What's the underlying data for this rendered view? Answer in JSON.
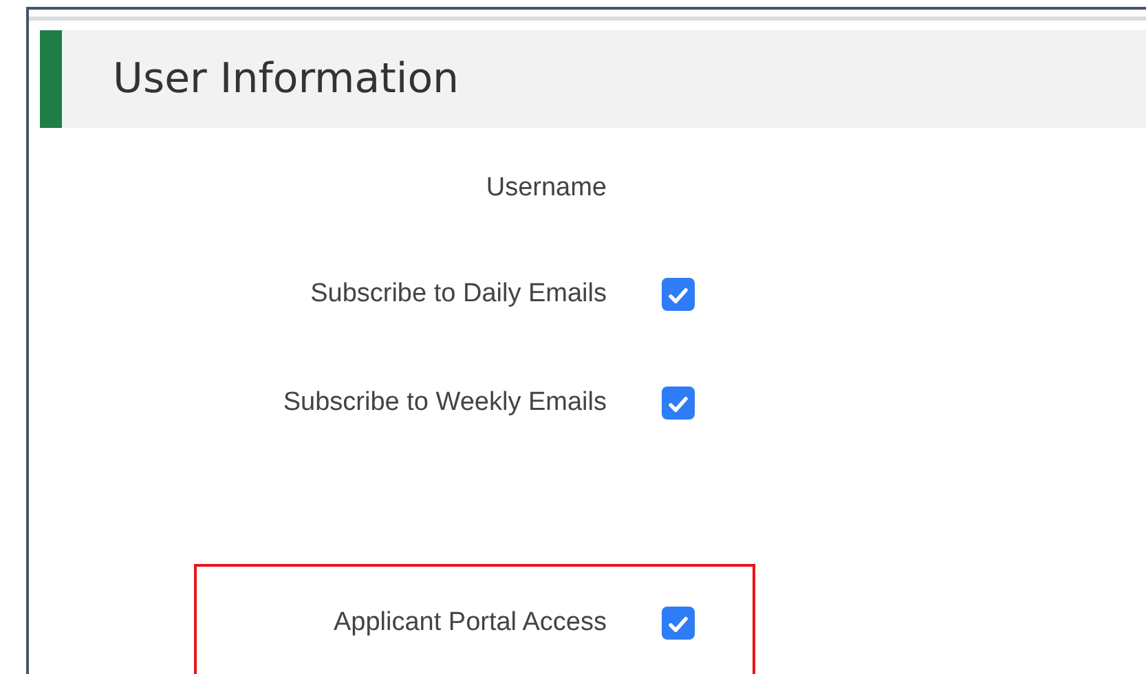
{
  "section": {
    "title": "User Information"
  },
  "fields": [
    {
      "kind": "text",
      "label": "Username",
      "highlighted": false
    },
    {
      "kind": "checkbox",
      "label": "Subscribe to Daily Emails",
      "checked": true,
      "highlighted": false
    },
    {
      "kind": "checkbox",
      "label": "Subscribe to Weekly Emails",
      "checked": true,
      "highlighted": false
    },
    {
      "kind": "checkbox",
      "label": "Applicant Portal Access",
      "checked": true,
      "highlighted": true
    }
  ]
}
